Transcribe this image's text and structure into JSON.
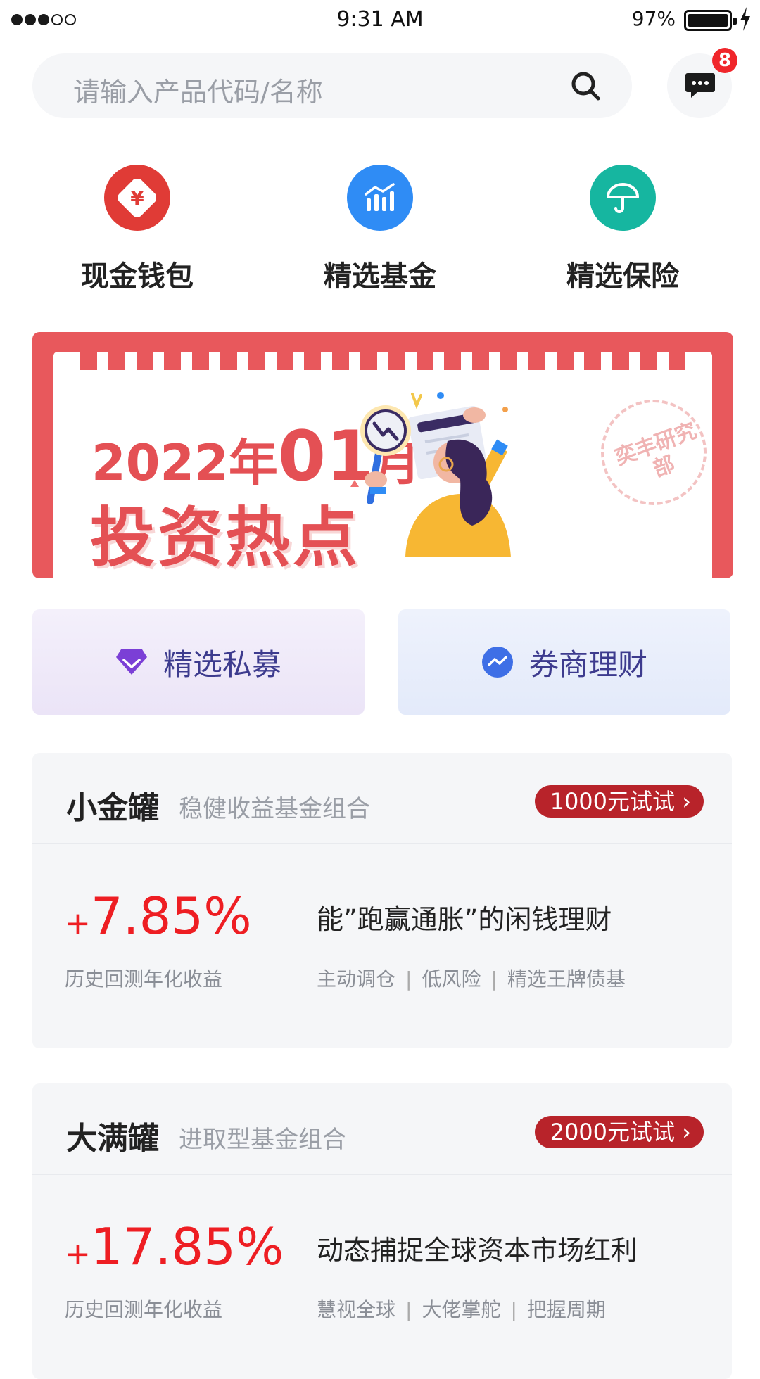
{
  "status_bar": {
    "time": "9:31 AM",
    "battery": "97%"
  },
  "search": {
    "placeholder": "请输入产品代码/名称"
  },
  "messages": {
    "badge_count": "8"
  },
  "quick_entries": [
    {
      "label": "现金钱包",
      "icon": "red-envelope-yuan-icon",
      "color": "#e03b36"
    },
    {
      "label": "精选基金",
      "icon": "bar-chart-trend-icon",
      "color": "#2f8cf5"
    },
    {
      "label": "精选保险",
      "icon": "umbrella-icon",
      "color": "#16b6a0"
    }
  ],
  "banner": {
    "year": "2022年",
    "month_num": "01",
    "month_unit": "月",
    "headline": "投资热点",
    "stamp": "奕丰研究部",
    "color": "#e8585c"
  },
  "shortcuts": [
    {
      "label": "精选私募",
      "icon": "diamond-icon"
    },
    {
      "label": "券商理财",
      "icon": "trend-circle-icon"
    }
  ],
  "products": [
    {
      "name": "小金罐",
      "desc": "稳健收益基金组合",
      "try_label": "1000元试试",
      "rate_sign": "+",
      "rate_value": "7.85%",
      "rate_label": "历史回测年化收益",
      "slogan": "能”跑赢通胀”的闲钱理财",
      "tags": [
        "主动调仓",
        "低风险",
        "精选王牌债基"
      ]
    },
    {
      "name": "大满罐",
      "desc": "进取型基金组合",
      "try_label": "2000元试试",
      "rate_sign": "+",
      "rate_value": "17.85%",
      "rate_label": "历史回测年化收益",
      "slogan": "动态捕捉全球资本市场红利",
      "tags": [
        "慧视全球",
        "大佬掌舵",
        "把握周期"
      ]
    }
  ]
}
